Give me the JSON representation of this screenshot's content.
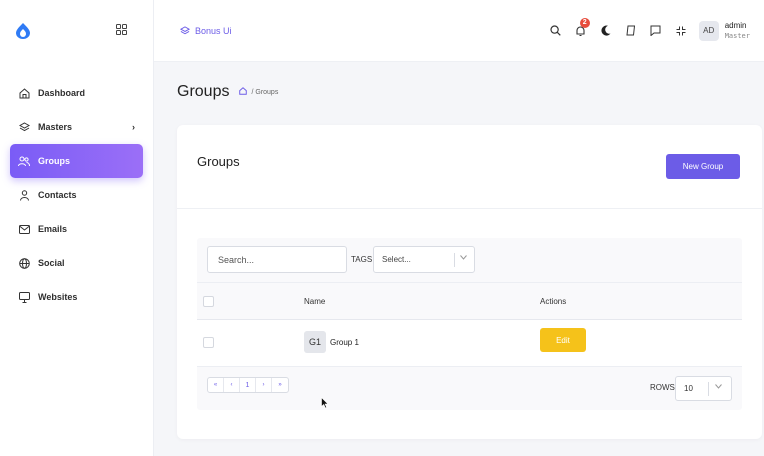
{
  "brand": {
    "name": "Bonus Ui",
    "accent": "#6c5ce7"
  },
  "sidebar": {
    "items": [
      {
        "label": "Dashboard",
        "icon": "home-icon"
      },
      {
        "label": "Masters",
        "icon": "layers-icon",
        "chevron": "›"
      },
      {
        "label": "Groups",
        "icon": "users-icon",
        "active": true
      },
      {
        "label": "Contacts",
        "icon": "user-icon"
      },
      {
        "label": "Emails",
        "icon": "mail-icon"
      },
      {
        "label": "Social",
        "icon": "globe-icon"
      },
      {
        "label": "Websites",
        "icon": "monitor-icon"
      }
    ]
  },
  "topbar": {
    "notification_count": "2",
    "avatar_initials": "AD",
    "user_name": "admin",
    "user_role": "Master"
  },
  "page": {
    "title": "Groups",
    "breadcrumb_sep": "/",
    "breadcrumb": "Groups"
  },
  "card": {
    "title": "Groups",
    "new_button": "New Group",
    "search_placeholder": "Search...",
    "tags_label": "TAGS",
    "tags_placeholder": "Select...",
    "columns": {
      "name": "Name",
      "actions": "Actions"
    },
    "rows": [
      {
        "initials": "G1",
        "name": "Group 1",
        "action": "Edit"
      }
    ],
    "pager": {
      "first": "«",
      "prev": "‹",
      "page": "1",
      "next": "›",
      "last": "»"
    },
    "rows_label": "ROWS",
    "rows_per_page": "10"
  }
}
